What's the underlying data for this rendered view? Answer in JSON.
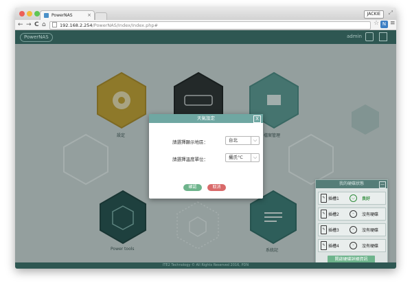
{
  "browser": {
    "tab_title": "PowerNAS",
    "tab_close": "×",
    "user_chip": "JACKIE",
    "url_host": "192.168.2.254",
    "url_path": "/PowerNAS/Index/Index.php#",
    "nav_back": "←",
    "nav_forward": "→",
    "nav_reload": "C",
    "nav_home": "⌂",
    "star": "☆",
    "extension_badge": "N",
    "menu": "≡",
    "resize": "⤢"
  },
  "app": {
    "logo": "PowerNAS",
    "user": "admin",
    "footer": "ITE2 Technology © All Rights Reserved 2016, PDN",
    "tiles": {
      "settings": "設定",
      "file_manager": "檔案管理",
      "power_tools": "Power tools",
      "system_log": "系統記"
    }
  },
  "modal": {
    "title": "天氣設定",
    "close": "X",
    "region_label": "請選擇顯示地區：",
    "region_value": "台北",
    "unit_label": "請選擇溫度單位：",
    "unit_value": "攝氏°C",
    "confirm": "確認",
    "cancel": "取消"
  },
  "disk_panel": {
    "title": "我的硬碟狀態",
    "minimize": "—",
    "slots": [
      {
        "label": "插槽1",
        "status": "良好"
      },
      {
        "label": "插槽2",
        "status": "沒有硬碟"
      },
      {
        "label": "插槽3",
        "status": "沒有硬碟"
      },
      {
        "label": "插槽4",
        "status": "沒有硬碟"
      }
    ],
    "button": "開啟硬碟詳細資訊"
  },
  "colors": {
    "header": "#2e5752",
    "modal_header": "#6fa7a2",
    "confirm": "#6eb48c",
    "cancel": "#d96a6a",
    "good": "#2e8b3a"
  }
}
